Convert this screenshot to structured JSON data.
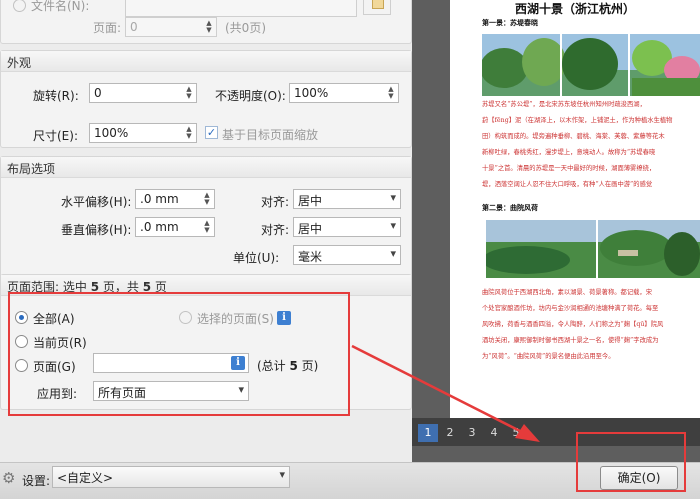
{
  "top": {
    "filename_label": "文件名(N):",
    "page_label": "页面:",
    "page_value": "0",
    "page_total": "(共0页)"
  },
  "appearance": {
    "title": "外观",
    "rotation_label": "旋转(R):",
    "rotation_value": "0",
    "opacity_label": "不透明度(O):",
    "opacity_value": "100%",
    "size_label": "尺寸(E):",
    "size_value": "100%",
    "scale_checkbox_label": "基于目标页面缩放"
  },
  "layout": {
    "title": "布局选项",
    "h_offset_label": "水平偏移(H):",
    "h_offset_value": ".0 mm",
    "v_offset_label": "垂直偏移(H):",
    "v_offset_value": ".0 mm",
    "align_label_1": "对齐:",
    "align_value_1": "居中",
    "align_label_2": "对齐:",
    "align_value_2": "居中",
    "unit_label": "单位(U):",
    "unit_value": "毫米"
  },
  "page_range": {
    "title_prefix": "页面范围: 选中 ",
    "selected": "5",
    "title_mid": " 页，共 ",
    "total": "5",
    "title_suffix": " 页",
    "all_label": "全部(A)",
    "selected_pages_label": "选择的页面(S)",
    "current_label": "当前页(R)",
    "pages_label": "页面(G)",
    "pages_total_prefix": "(总计 ",
    "pages_total_value": "5",
    "pages_total_suffix": " 页)",
    "apply_to_label": "应用到:",
    "apply_to_value": "所有页面"
  },
  "preview": {
    "doc_title": "西湖十景（浙江杭州）",
    "section1_heading": "第一景：苏堤春晓",
    "section1_lines": [
      "苏堤又名“苏公堤”，是北宋苏东坡任杭州知州时疏浚西湖，",
      "葑【fēng】泥（在湖泽上，以木作架，上铺泥土，作为种植水生植物",
      "田）构筑而成的。堤旁遍种垂柳、碧桃、海棠、芙蓉、紫藤等花木",
      "新柳吐绿，春桃秀红，漫步堤上，意境动人。故称为“苏堤春晓",
      "十景”之首。清晨的苏堤是一天中最好的时候，湖面薄雾缭绕，",
      "堤，洒落空阔让人忍不住大口呼吸，有种“人在画中游”的感觉"
    ],
    "section2_heading": "第二景：曲院风荷",
    "section2_lines": [
      "曲院风荷位于西湖西北角，素以湖景、荷景著称。都记载，宋",
      "个处官家酿酒作坊，坊内与金沙润相通的池塘种满了荷花。每至",
      "风吹拂，荷香与酒香四溢，令人陶醉，人们称之为“麹【qū】院风",
      "酒坊关闭，康熙御制时御书西湖十景之一名，使得“麹”字改成为",
      "为“风荷”。“曲院风荷”的景名便由此沿用至今。"
    ],
    "pages": [
      "1",
      "2",
      "3",
      "4",
      "5"
    ],
    "active_page": "1"
  },
  "bottom": {
    "settings_label": "设置:",
    "settings_value": "<自定义>",
    "ok_label": "确定(O)"
  },
  "colors": {
    "highlight_box": "#e53b3b",
    "arrow": "#e53b3b",
    "info_button": "#3d7fd1",
    "radio_dot": "#2a6bbf",
    "page_active": "#3f6fb0"
  }
}
